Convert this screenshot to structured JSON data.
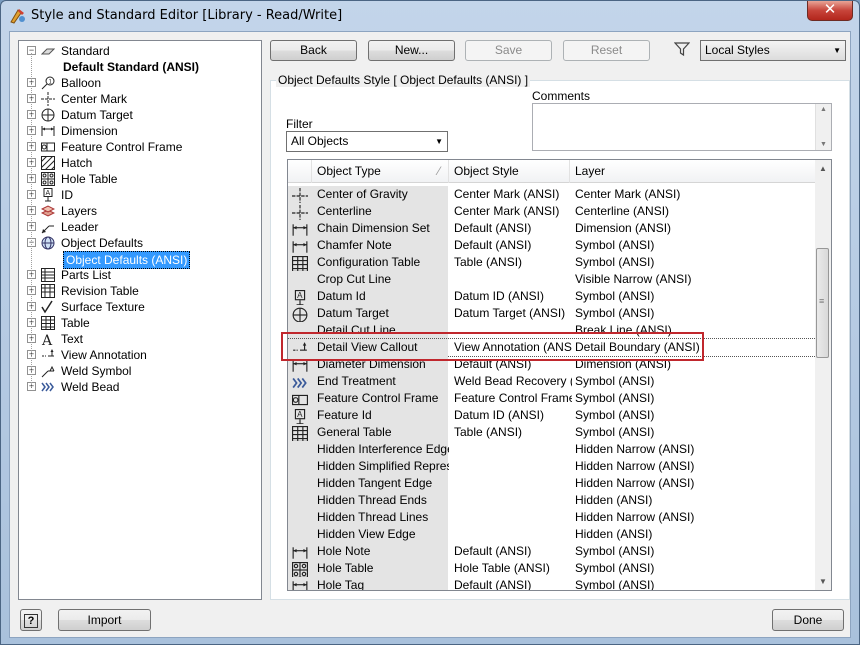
{
  "window": {
    "title": "Style and Standard Editor [Library - Read/Write]",
    "close_label": "✕"
  },
  "tree": {
    "items": [
      {
        "label": "Standard",
        "icon": "standard-icon",
        "level": 0,
        "expander": "−"
      },
      {
        "label": "Default Standard (ANSI)",
        "level": 1,
        "bold": true
      },
      {
        "label": "Balloon",
        "icon": "balloon-icon",
        "level": 0,
        "expander": "+"
      },
      {
        "label": "Center Mark",
        "icon": "center-mark-icon",
        "level": 0,
        "expander": "+"
      },
      {
        "label": "Datum Target",
        "icon": "datum-target-icon",
        "level": 0,
        "expander": "+"
      },
      {
        "label": "Dimension",
        "icon": "dimension-icon",
        "level": 0,
        "expander": "+"
      },
      {
        "label": "Feature Control Frame",
        "icon": "feature-control-frame-icon",
        "level": 0,
        "expander": "+"
      },
      {
        "label": "Hatch",
        "icon": "hatch-icon",
        "level": 0,
        "expander": "+"
      },
      {
        "label": "Hole Table",
        "icon": "hole-table-icon",
        "level": 0,
        "expander": "+"
      },
      {
        "label": "ID",
        "icon": "id-icon",
        "level": 0,
        "expander": "+"
      },
      {
        "label": "Layers",
        "icon": "layers-icon",
        "level": 0,
        "expander": "+"
      },
      {
        "label": "Leader",
        "icon": "leader-icon",
        "level": 0,
        "expander": "+"
      },
      {
        "label": "Object Defaults",
        "icon": "object-defaults-icon",
        "level": 0,
        "expander": "−"
      },
      {
        "label": "Object Defaults (ANSI)",
        "level": 1,
        "selected": true
      },
      {
        "label": "Parts List",
        "icon": "parts-list-icon",
        "level": 0,
        "expander": "+"
      },
      {
        "label": "Revision Table",
        "icon": "revision-table-icon",
        "level": 0,
        "expander": "+"
      },
      {
        "label": "Surface Texture",
        "icon": "surface-texture-icon",
        "level": 0,
        "expander": "+"
      },
      {
        "label": "Table",
        "icon": "table-icon",
        "level": 0,
        "expander": "+"
      },
      {
        "label": "Text",
        "icon": "text-icon",
        "level": 0,
        "expander": "+"
      },
      {
        "label": "View Annotation",
        "icon": "view-annotation-icon",
        "level": 0,
        "expander": "+"
      },
      {
        "label": "Weld Symbol",
        "icon": "weld-symbol-icon",
        "level": 0,
        "expander": "+"
      },
      {
        "label": "Weld Bead",
        "icon": "weld-bead-icon",
        "level": 0,
        "expander": "+"
      }
    ]
  },
  "toolbar": {
    "back_label": "Back",
    "new_label": "New...",
    "save_label": "Save",
    "reset_label": "Reset",
    "filter_icon": "filter-icon",
    "styles_filter": "Local Styles"
  },
  "panel": {
    "group_title": "Object Defaults Style [ Object Defaults (ANSI) ]",
    "comments_label": "Comments",
    "filter_label": "Filter",
    "filter_value": "All Objects"
  },
  "grid": {
    "columns": [
      "Object Type",
      "Object Style",
      "Layer"
    ],
    "rows": [
      {
        "type": "Center of Gravity",
        "style": "Center Mark (ANSI)",
        "layer": "Center Mark (ANSI)",
        "icon": "center-mark-icon"
      },
      {
        "type": "Centerline",
        "style": "Center Mark (ANSI)",
        "layer": "Centerline (ANSI)",
        "icon": "center-mark-icon"
      },
      {
        "type": "Chain Dimension Set",
        "style": "Default (ANSI)",
        "layer": "Dimension (ANSI)",
        "icon": "dimension-icon"
      },
      {
        "type": "Chamfer Note",
        "style": "Default (ANSI)",
        "layer": "Symbol (ANSI)",
        "icon": "dimension-icon"
      },
      {
        "type": "Configuration Table",
        "style": "Table (ANSI)",
        "layer": "Symbol (ANSI)",
        "icon": "table-icon"
      },
      {
        "type": "Crop Cut Line",
        "style": "",
        "layer": "Visible Narrow (ANSI)",
        "icon": ""
      },
      {
        "type": "Datum Id",
        "style": "Datum ID (ANSI)",
        "layer": "Symbol (ANSI)",
        "icon": "id-icon"
      },
      {
        "type": "Datum Target",
        "style": "Datum Target (ANSI)",
        "layer": "Symbol (ANSI)",
        "icon": "datum-target-icon"
      },
      {
        "type": "Detail Cut Line",
        "style": "",
        "layer": "Break Line (ANSI)",
        "icon": ""
      },
      {
        "type": "Detail View Callout",
        "style": "View Annotation (ANSI)",
        "layer": "Detail Boundary (ANSI)",
        "icon": "view-annotation-icon",
        "focused": true
      },
      {
        "type": "Diameter Dimension",
        "style": "Default (ANSI)",
        "layer": "Dimension (ANSI)",
        "icon": "dimension-icon"
      },
      {
        "type": "End Treatment",
        "style": "Weld Bead Recovery (AN",
        "layer": "Symbol (ANSI)",
        "icon": "weld-bead-icon"
      },
      {
        "type": "Feature Control Frame",
        "style": "Feature Control Frame (",
        "layer": "Symbol (ANSI)",
        "icon": "feature-control-frame-icon"
      },
      {
        "type": "Feature Id",
        "style": "Datum ID (ANSI)",
        "layer": "Symbol (ANSI)",
        "icon": "id-icon"
      },
      {
        "type": "General Table",
        "style": "Table (ANSI)",
        "layer": "Symbol (ANSI)",
        "icon": "table-icon"
      },
      {
        "type": "Hidden Interference Edge",
        "style": "",
        "layer": "Hidden Narrow (ANSI)",
        "icon": ""
      },
      {
        "type": "Hidden Simplified Represent",
        "style": "",
        "layer": "Hidden Narrow (ANSI)",
        "icon": ""
      },
      {
        "type": "Hidden Tangent Edge",
        "style": "",
        "layer": "Hidden Narrow (ANSI)",
        "icon": ""
      },
      {
        "type": "Hidden Thread Ends",
        "style": "",
        "layer": "Hidden (ANSI)",
        "icon": ""
      },
      {
        "type": "Hidden Thread Lines",
        "style": "",
        "layer": "Hidden Narrow (ANSI)",
        "icon": ""
      },
      {
        "type": "Hidden View Edge",
        "style": "",
        "layer": "Hidden (ANSI)",
        "icon": ""
      },
      {
        "type": "Hole Note",
        "style": "Default (ANSI)",
        "layer": "Symbol (ANSI)",
        "icon": "dimension-icon"
      },
      {
        "type": "Hole Table",
        "style": "Hole Table (ANSI)",
        "layer": "Symbol (ANSI)",
        "icon": "hole-table-icon"
      },
      {
        "type": "Hole Tag",
        "style": "Default (ANSI)",
        "layer": "Symbol (ANSI)",
        "icon": "dimension-icon"
      }
    ]
  },
  "footer": {
    "help_label": "?",
    "import_label": "Import",
    "done_label": "Done"
  }
}
